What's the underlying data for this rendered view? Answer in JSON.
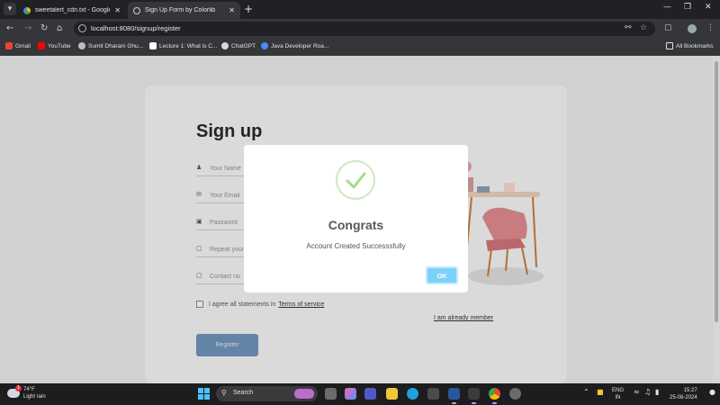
{
  "browser": {
    "tabs": [
      {
        "title": "sweetalert_cdn.txt - Google Dri",
        "favicon": "google-drive-icon",
        "active": false
      },
      {
        "title": "Sign Up Form by Colorlib",
        "favicon": "globe-icon",
        "active": true
      }
    ],
    "url": "localhost:8080/signup/register",
    "bookmarks": [
      {
        "label": "Gmail",
        "icon": "gmail-icon",
        "color": "#ea4335"
      },
      {
        "label": "YouTube",
        "icon": "youtube-icon",
        "color": "#ff0000"
      },
      {
        "label": "Sumit Dharam Ghu...",
        "icon": "globe-icon",
        "color": "#bdbdbd"
      },
      {
        "label": "Lecture 1: What is C...",
        "icon": "notion-icon",
        "color": "#ffffff"
      },
      {
        "label": "ChatGPT",
        "icon": "chatgpt-icon",
        "color": "#d9d9d9"
      },
      {
        "label": "Java Developer Roa...",
        "icon": "globe-icon",
        "color": "#4c8bf5"
      }
    ],
    "all_bookmarks_label": "All Bookmarks"
  },
  "form": {
    "title": "Sign up",
    "fields": [
      {
        "placeholder": "Your Name",
        "icon": "person-icon",
        "glyph": "♟"
      },
      {
        "placeholder": "Your Email",
        "icon": "envelope-icon",
        "glyph": "✉"
      },
      {
        "placeholder": "Password",
        "icon": "lock-icon",
        "glyph": "▣"
      },
      {
        "placeholder": "Repeat your password",
        "icon": "lock-outline-icon",
        "glyph": "▢"
      },
      {
        "placeholder": "Contact no",
        "icon": "lock-outline-icon",
        "glyph": "▢"
      }
    ],
    "agree_text": "I agree all statements in",
    "terms_link": "Terms of service",
    "member_link": "I am already member",
    "register_button": "Register"
  },
  "alert": {
    "icon": "success-check-icon",
    "title": "Congrats",
    "message": "Account Created Successsfully",
    "ok_button": "OK",
    "accent_color": "#7cd1f9",
    "check_color": "#a5dc86"
  },
  "taskbar": {
    "weather_temp": "74°F",
    "weather_desc": "Light rain",
    "weather_badge": "1",
    "search_label": "Search",
    "language": "ENG",
    "region": "IN",
    "time": "15:27",
    "date": "25-08-2024"
  }
}
